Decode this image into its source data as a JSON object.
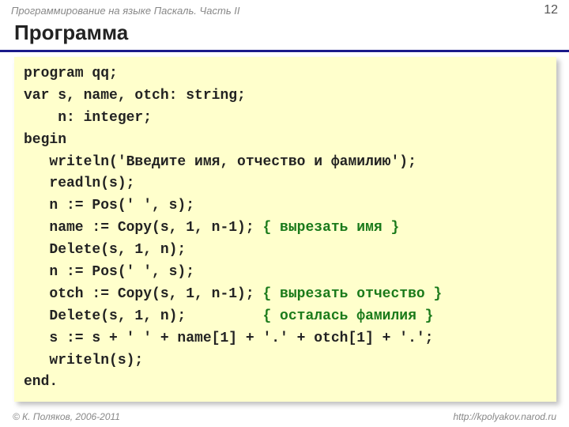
{
  "header": {
    "course": "Программирование на языке Паскаль. Часть II",
    "page": "12"
  },
  "title": "Программа",
  "code": {
    "l1": "program qq;",
    "l2": "var s, name, otch: string;",
    "l3": "    n: integer;",
    "l4": "begin",
    "l5": "   writeln('Введите имя, отчество и фамилию');",
    "l6": "   readln(s);",
    "l7": "   n := Pos(' ', s);",
    "l8a": "   name := Copy(s, 1, n-1); ",
    "l8c": "{ вырезать имя }",
    "l9": "   Delete(s, 1, n);",
    "l10": "   n := Pos(' ', s);",
    "l11a": "   otch := Copy(s, 1, n-1); ",
    "l11c": "{ вырезать отчество }",
    "l12a": "   Delete(s, 1, n);         ",
    "l12c": "{ осталась фамилия }",
    "l13": "   s := s + ' ' + name[1] + '.' + otch[1] + '.';",
    "l14": "   writeln(s);",
    "l15": "end."
  },
  "footer": {
    "copyright": "© К. Поляков, 2006-2011",
    "url": "http://kpolyakov.narod.ru"
  }
}
